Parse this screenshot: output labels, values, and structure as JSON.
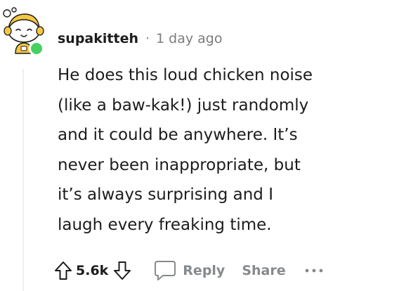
{
  "comment": {
    "username": "supakitteh",
    "separator": "·",
    "timestamp": "1 day ago",
    "body_lines": [
      "He does this loud chicken noise",
      "(like a baw-kak!) just randomly",
      "and it could be anywhere. It’s",
      "never been inappropriate, but",
      "it’s always surprising and I",
      "laugh every freaking time."
    ],
    "score": "5.6k",
    "reply_label": "Reply",
    "share_label": "Share"
  },
  "icons": {
    "avatar": "snoo-avatar",
    "online": "online-status-dot",
    "upvote": "upvote-arrow-icon",
    "downvote": "downvote-arrow-icon",
    "reply": "speech-bubble-icon",
    "more": "more-options-icon"
  },
  "colors": {
    "text": "#1c1c1c",
    "muted": "#878a8c",
    "online": "#46d160",
    "avatar_accent": "#f5c842",
    "thread_line": "#edeff1"
  }
}
